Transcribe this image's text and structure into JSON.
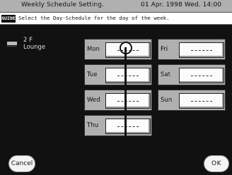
{
  "window": {
    "title": "Weekly Schedule Setting.",
    "datetime": "01 Apr. 1998 Wed. 14:00"
  },
  "guide": {
    "badge": "GUIDE",
    "text": "Select the Day-Schedule for the day of the week."
  },
  "location": {
    "icon": "room-icon",
    "floor": "2 F",
    "room": "Lounge"
  },
  "days": [
    {
      "key": "mon",
      "label": "Mon"
    },
    {
      "key": "tue",
      "label": "Tue"
    },
    {
      "key": "wed",
      "label": "Wed"
    },
    {
      "key": "thu",
      "label": "Thu"
    },
    {
      "key": "fri",
      "label": "Fri"
    },
    {
      "key": "sat",
      "label": "Sat"
    },
    {
      "key": "sun",
      "label": "Sun"
    }
  ],
  "buttons": {
    "cancel": "Cancel",
    "ok": "OK"
  }
}
